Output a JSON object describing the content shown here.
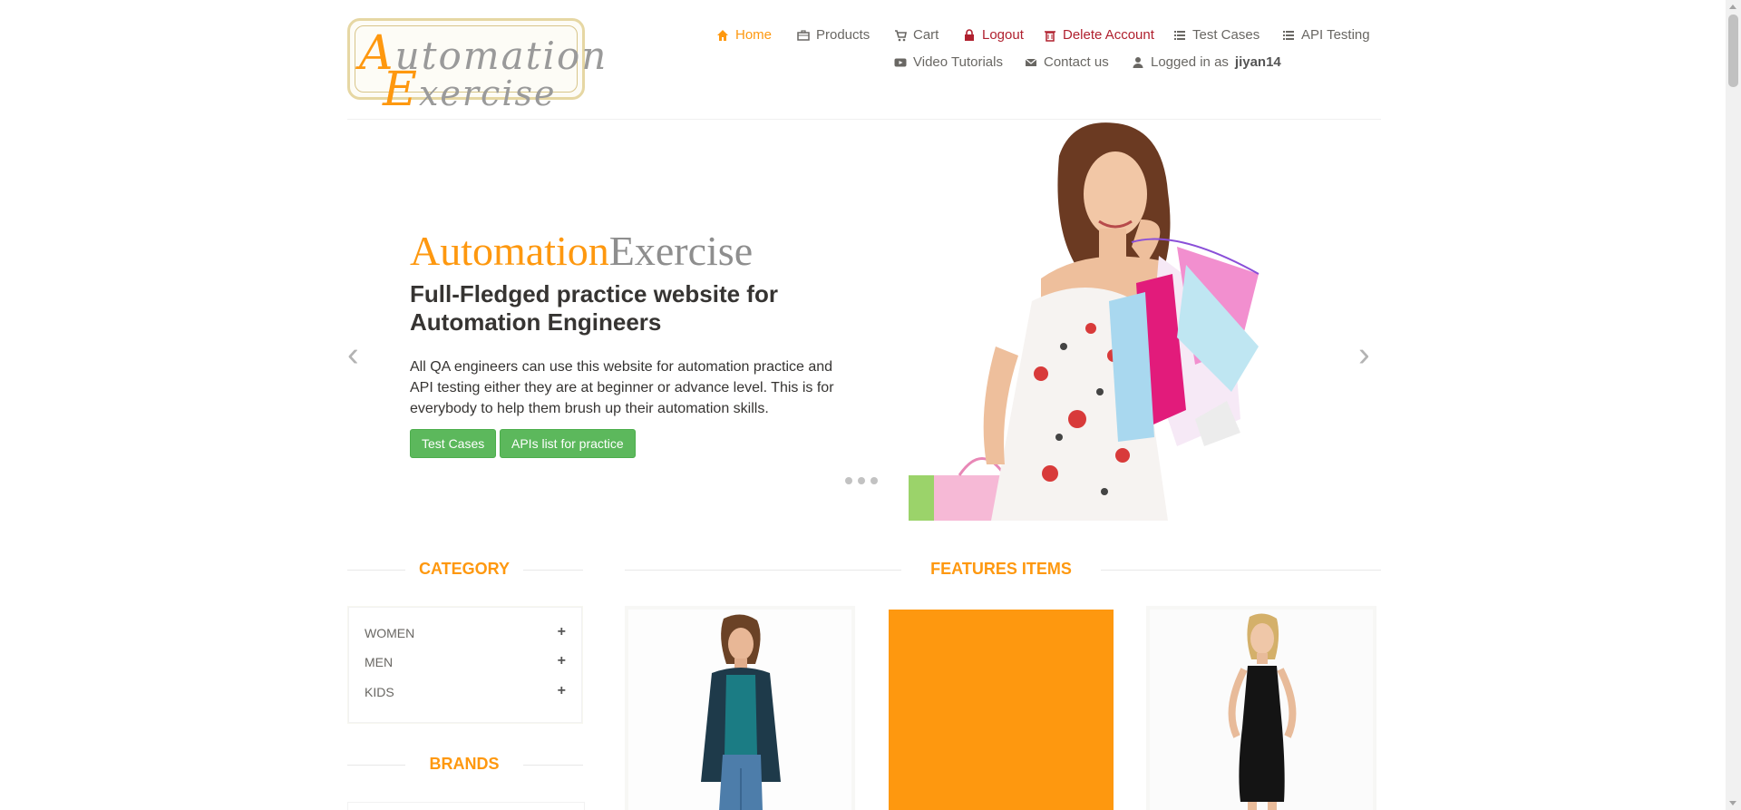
{
  "logo": {
    "line1_cap": "A",
    "line1_rest": "utomation",
    "line2_cap": "E",
    "line2_rest": "xercise"
  },
  "nav": {
    "home": "Home",
    "products": "Products",
    "cart": "Cart",
    "logout": "Logout",
    "delete_account": "Delete Account",
    "test_cases": "Test Cases",
    "api_testing": "API Testing",
    "video_tutorials": "Video Tutorials",
    "contact_us": "Contact us",
    "logged_in_prefix": "Logged in as",
    "username": "jiyan14"
  },
  "slider": {
    "brand_a": "Automation",
    "brand_b": "Exercise",
    "headline": "Full-Fledged practice website for Automation Engineers",
    "description": "All QA engineers can use this website for automation practice and API testing either they are at beginner or advance level. This is for everybody to help them brush up their automation skills.",
    "btn_test_cases": "Test Cases",
    "btn_apis": "APIs list for practice",
    "prev": "‹",
    "next": "›"
  },
  "sidebar": {
    "category_title": "CATEGORY",
    "categories": [
      {
        "label": "WOMEN"
      },
      {
        "label": "MEN"
      },
      {
        "label": "KIDS"
      }
    ],
    "brands_title": "BRANDS"
  },
  "features": {
    "title": "FEATURES ITEMS"
  },
  "colors": {
    "accent": "#FE980F",
    "button": "#5CB85C",
    "danger": "#B0202E"
  }
}
